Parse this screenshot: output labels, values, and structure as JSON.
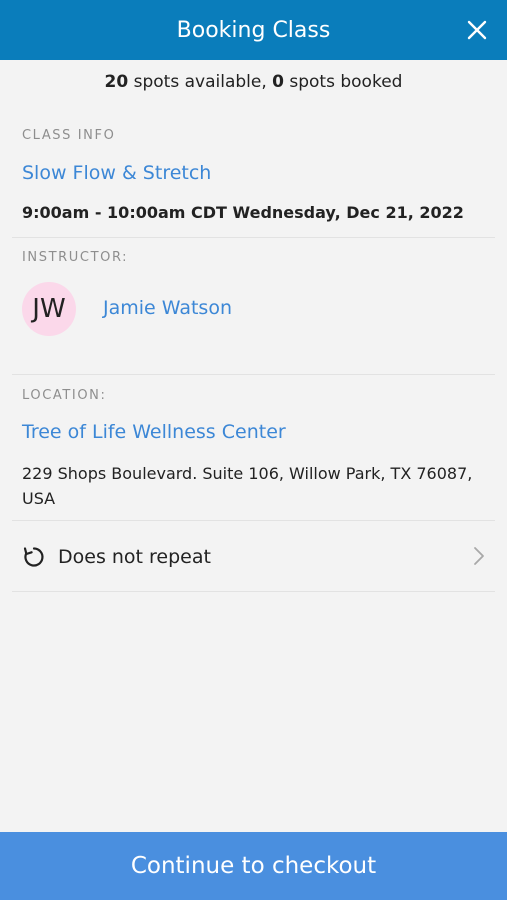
{
  "header": {
    "title": "Booking Class",
    "close_icon": "close-icon"
  },
  "availability": {
    "available_count": "20",
    "available_text": " spots available, ",
    "booked_count": "0",
    "booked_text": " spots booked"
  },
  "class_info": {
    "label": "CLASS INFO",
    "name": "Slow Flow & Stretch",
    "datetime": "9:00am - 10:00am CDT Wednesday, Dec 21, 2022"
  },
  "instructor": {
    "label": "INSTRUCTOR:",
    "initials": "JW",
    "name": "Jamie Watson"
  },
  "location": {
    "label": "LOCATION:",
    "name": "Tree of Life Wellness Center",
    "address": "229 Shops Boulevard. Suite 106, Willow Park, TX 76087, USA"
  },
  "repeat": {
    "label": "Does not repeat",
    "icon": "repeat-icon",
    "chevron": "chevron-right-icon"
  },
  "footer": {
    "button_label": "Continue to checkout"
  },
  "colors": {
    "header": "#0a7dbb",
    "link": "#3c87d6",
    "footer": "#4a8fdf",
    "avatar": "#fbd8ea"
  }
}
